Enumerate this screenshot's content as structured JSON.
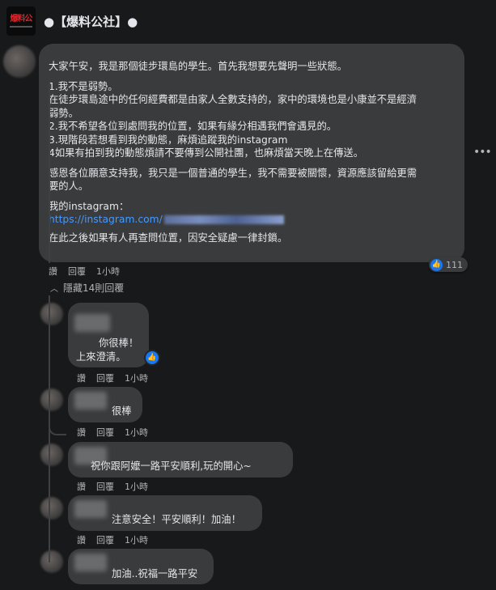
{
  "page": {
    "name": "●【爆料公社】●",
    "logo_text": "爆料公"
  },
  "post": {
    "lines": [
      "大家午安，我是那個徒步環島的學生。首先我想要先聲明一些狀態。",
      "",
      "1.我不是弱勢。",
      "在徒步環島途中的任何經費都是由家人全數支持的，家中的環境也是小康並不是經濟",
      "弱勢。",
      "2.我不希望各位到處問我的位置，如果有緣分相遇我們會遇見的。",
      "3.現階段若想看到我的動態，麻煩追蹤我的instagram",
      "4如果有拍到我的動態煩請不要傳到公開社團，也麻煩當天晚上在傳送。",
      "",
      "感恩各位願意支持我，我只是一個普通的學生，我不需要被關懷，資源應該留給更需",
      "要的人。",
      "",
      "我的instagram："
    ],
    "link": "https://instagram.com/",
    "last_line": "在此之後如果有人再查問位置，因安全疑慮一律封鎖。",
    "reaction_count": "111",
    "actions": {
      "like": "讚",
      "reply": "回覆",
      "time": "1小時"
    }
  },
  "hidden_replies_label": "隱藏14則回覆",
  "replies": [
    {
      "text_lines": [
        "你很棒！",
        "上來澄清。"
      ],
      "liked": true,
      "actions": {
        "like": "讚",
        "reply": "回覆",
        "time": "1小時"
      }
    },
    {
      "text_lines": [
        "很棒"
      ],
      "liked": false,
      "actions": {
        "like": "讚",
        "reply": "回覆",
        "time": "1小時"
      }
    },
    {
      "text_lines": [
        "祝你跟阿嬤一路平安順利,玩的開心~"
      ],
      "liked": false,
      "actions": {
        "like": "讚",
        "reply": "回覆",
        "time": "1小時"
      }
    },
    {
      "text_lines": [
        "注意安全！平安順利！加油！"
      ],
      "liked": false,
      "actions": {
        "like": "讚",
        "reply": "回覆",
        "time": "1小時"
      }
    },
    {
      "text_lines": [
        "加油..祝福一路平安"
      ],
      "liked": false
    }
  ],
  "colors": {
    "background": "#18191a",
    "bubble": "#3a3b3c",
    "link": "#4599ff",
    "like": "#1877f2"
  },
  "icons": {
    "like": "thumbs-up-icon",
    "more": "more-options-icon",
    "chevron": "chevron-up-icon"
  }
}
